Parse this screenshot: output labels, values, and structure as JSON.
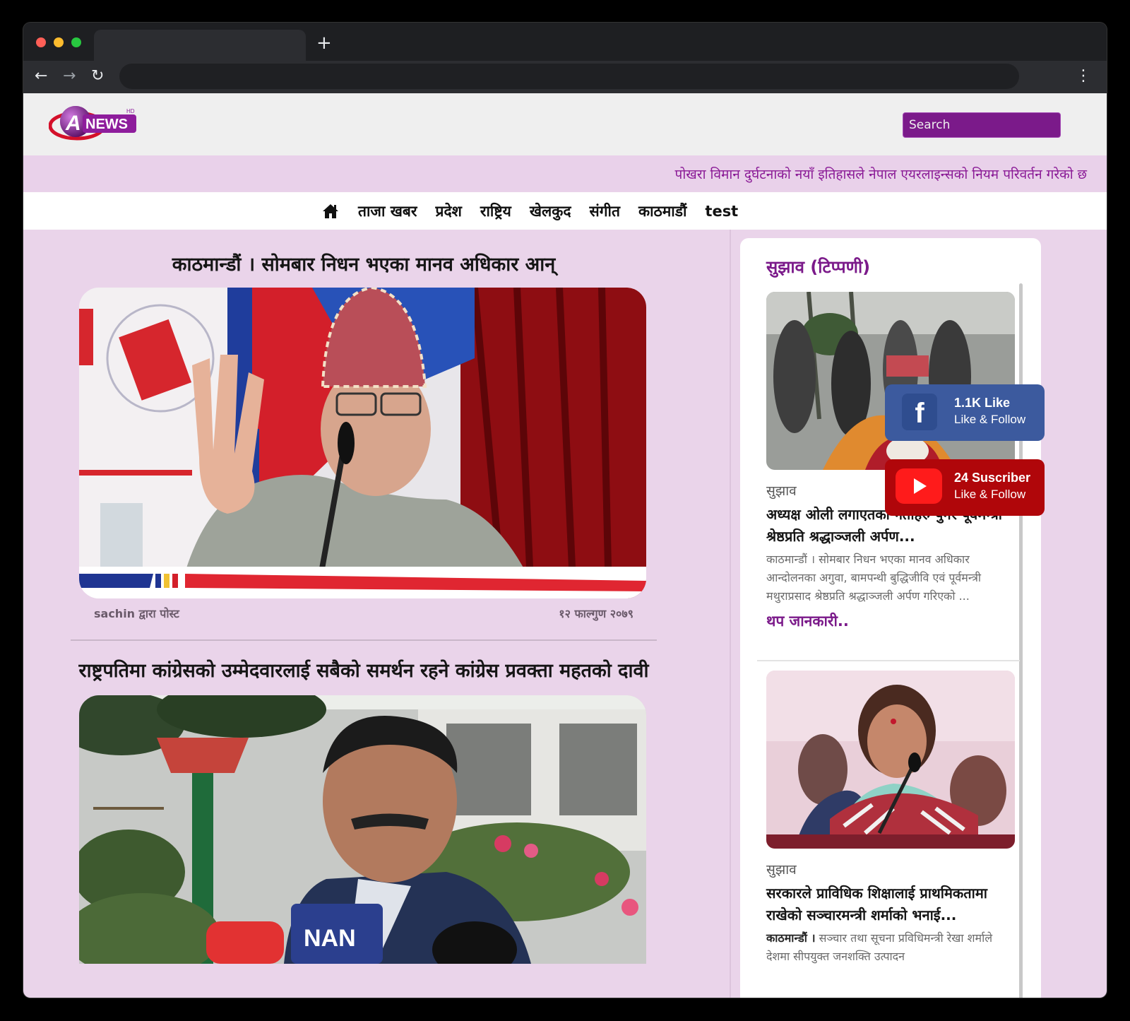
{
  "browser": {
    "new_tab": "+",
    "back": "←",
    "forward": "→",
    "reload": "↻",
    "menu": "⋮"
  },
  "site": {
    "logo_text": "NEWS",
    "logo_badge": "HD",
    "search_placeholder": "Search"
  },
  "ticker": {
    "text": "पोखरा विमान दुर्घटनाको नयाँ इतिहासले नेपाल एयरलाइन्सको नियम परिवर्तन गरेको छ"
  },
  "nav": {
    "items": [
      "ताजा खबर",
      "प्रदेश",
      "राष्ट्रिय",
      "खेलकुद",
      "संगीत",
      "काठमाडौं",
      "test"
    ]
  },
  "articles": [
    {
      "title": "काठमान्डौं । सोमबार निधन भएका मानव अधिकार आन्",
      "author": "sachin द्वारा पोस्ट",
      "date": "१२ फाल्गुण २०७९"
    },
    {
      "title": "राष्ट्रपतिमा कांग्रेसको उम्मेदवारलाई सबैको समर्थन रहने कांग्रेस प्रवक्ता महतको दावी",
      "mic_label": "NAN"
    }
  ],
  "sidebar": {
    "title": "सुझाव (टिप्पणी)",
    "cards": [
      {
        "category": "सुझाव",
        "headline": "अध्यक्ष ओली लगाएतका नेताहरु पुगेर पूर्वमन्त्री श्रेष्ठप्रति श्रद्धाञ्जली अर्पण...",
        "desc": "काठमान्डौं । सोमबार निधन भएका मानव अधिकार आन्दोलनका अगुवा, बामपन्थी बुद्धिजीवि एवं पूर्वमन्त्री मथुराप्रसाद श्रेष्ठप्रति श्रद्धाञ्जली अर्पण गरिएको ...",
        "more": "थप जानकारी.."
      },
      {
        "category": "सुझाव",
        "headline": "सरकारले प्राविधिक शिक्षालाई प्राथमिकतामा राखेको सञ्चारमन्त्री शर्माको भनाई...",
        "desc_lead": "काठमान्डौं ।",
        "desc": " सञ्चार तथा सूचना प्रविधिमन्त्री रेखा शर्माले देशमा सीपयुक्त जनशक्ति उत्पादन"
      }
    ]
  },
  "social": {
    "facebook": {
      "count": "1.1K Like",
      "label": "Like & Follow",
      "color": "#3c5a9e"
    },
    "youtube": {
      "count": "24 Suscriber",
      "label": "Like & Follow",
      "color": "#b0060a"
    }
  }
}
